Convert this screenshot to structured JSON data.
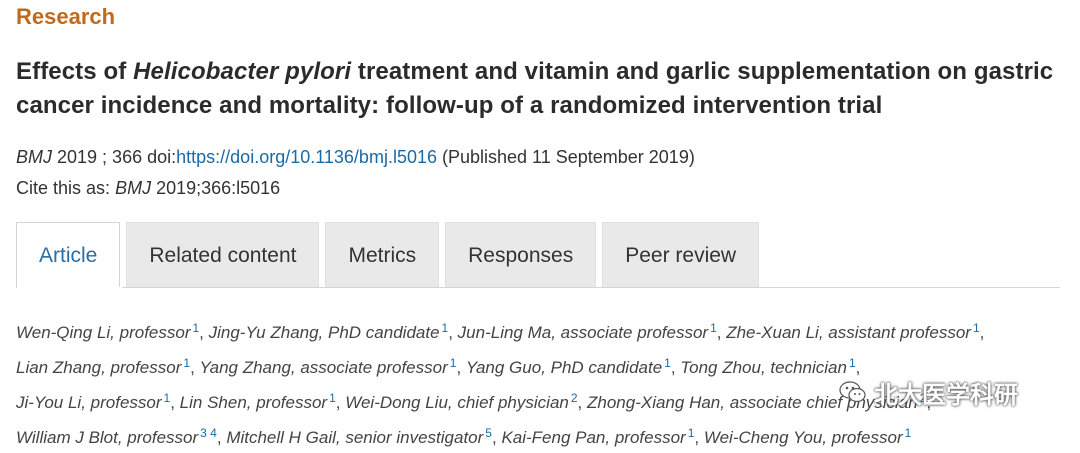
{
  "header": {
    "section": "Research",
    "title_pre": "Effects of ",
    "title_italic": "Helicobacter pylori",
    "title_post": " treatment and vitamin and garlic supplementation on gastric cancer incidence and mortality: follow-up of a randomized intervention trial"
  },
  "citation": {
    "journal": "BMJ",
    "year_vol": "2019 ; 366",
    "doi_label": "doi:",
    "doi_url": "https://doi.org/10.1136/bmj.l5016",
    "published": "(Published 11 September 2019)",
    "cite_label": "Cite this as:",
    "cite_journal": "BMJ",
    "cite_ref": "2019;366:l5016"
  },
  "tabs": [
    {
      "label": "Article",
      "active": true
    },
    {
      "label": "Related content",
      "active": false
    },
    {
      "label": "Metrics",
      "active": false
    },
    {
      "label": "Responses",
      "active": false
    },
    {
      "label": "Peer review",
      "active": false
    }
  ],
  "authors": [
    {
      "name": "Wen-Qing Li, professor",
      "aff": "1"
    },
    {
      "name": "Jing-Yu Zhang, PhD candidate",
      "aff": "1"
    },
    {
      "name": "Jun-Ling Ma, associate professor",
      "aff": "1"
    },
    {
      "name": "Zhe-Xuan Li, assistant professor",
      "aff": "1"
    },
    {
      "name": "Lian Zhang, professor",
      "aff": "1"
    },
    {
      "name": "Yang Zhang, associate professor",
      "aff": "1"
    },
    {
      "name": "Yang Guo, PhD candidate",
      "aff": "1"
    },
    {
      "name": "Tong Zhou, technician",
      "aff": "1"
    },
    {
      "name": "Ji-You Li, professor",
      "aff": "1"
    },
    {
      "name": "Lin Shen, professor",
      "aff": "1"
    },
    {
      "name": "Wei-Dong Liu, chief physician",
      "aff": "2"
    },
    {
      "name": "Zhong-Xiang Han, associate chief physician",
      "aff": "2"
    },
    {
      "name": "William J Blot, professor",
      "aff": "3 4"
    },
    {
      "name": "Mitchell H Gail, senior investigator",
      "aff": "5"
    },
    {
      "name": "Kai-Feng Pan, professor",
      "aff": "1"
    },
    {
      "name": "Wei-Cheng You, professor",
      "aff": "1"
    }
  ],
  "watermark": {
    "text": "北大医学科研",
    "icon": "wechat-icon"
  },
  "colors": {
    "section": "#c26a1c",
    "link": "#1a6aa6",
    "tab_active": "#2a6ea8",
    "tab_bg": "#e9e9e9"
  }
}
